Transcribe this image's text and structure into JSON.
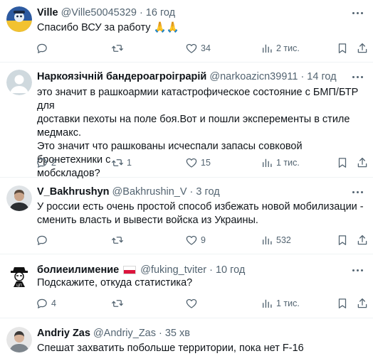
{
  "tweets": [
    {
      "name": "Ville",
      "handle": "@Ville50045329",
      "time": "16 год",
      "text": "Спасибо ВСУ за работу 🙏🙏",
      "replies": "",
      "retweets": "",
      "likes": "34",
      "views": "2 тис."
    },
    {
      "name": "Наркоязічній бандероагроіграрій",
      "handle": "@narkoazicn39911",
      "time": "14 год",
      "text_lines": [
        "это значит в рашкоармии катастрофическое состояние с БМП/БТР для",
        "доставки пехоты на поле боя.Вот и пошли эксперементы в стиле",
        "медмакс.",
        "Это значит что рашкованы исчеспали запасы совковой бронетехники с",
        "мобскладов?"
      ],
      "replies": "2",
      "retweets": "1",
      "likes": "15",
      "views": "1 тис."
    },
    {
      "name": "V_Bakhrushyn",
      "handle": "@Bakhrushin_V",
      "time": "3 год",
      "text_lines": [
        "У россии есть очень простой способ избежать новой мобилизации -",
        "сменить власть и вывести войска из Украины."
      ],
      "replies": "",
      "retweets": "",
      "likes": "9",
      "views": "532"
    },
    {
      "name": "болиеилимение",
      "handle": "@fuking_tviter",
      "time": "10 год",
      "text": "Подскажите, откуда статистика?",
      "replies": "4",
      "retweets": "",
      "likes": "",
      "views": "1 тис."
    },
    {
      "name": "Andriy Zas",
      "handle": "@Andriy_Zas",
      "time": "35 хв",
      "text": "Спешат захватить побольше территории, пока нет F-16"
    }
  ],
  "separator": "·",
  "colors": {
    "text": "#0f1419",
    "secondary": "#536471",
    "divider": "#eff3f4",
    "flag_red": "#dc143c"
  },
  "icons": [
    "more-icon",
    "reply-icon",
    "retweet-icon",
    "like-icon",
    "views-icon",
    "bookmark-icon",
    "share-icon"
  ]
}
